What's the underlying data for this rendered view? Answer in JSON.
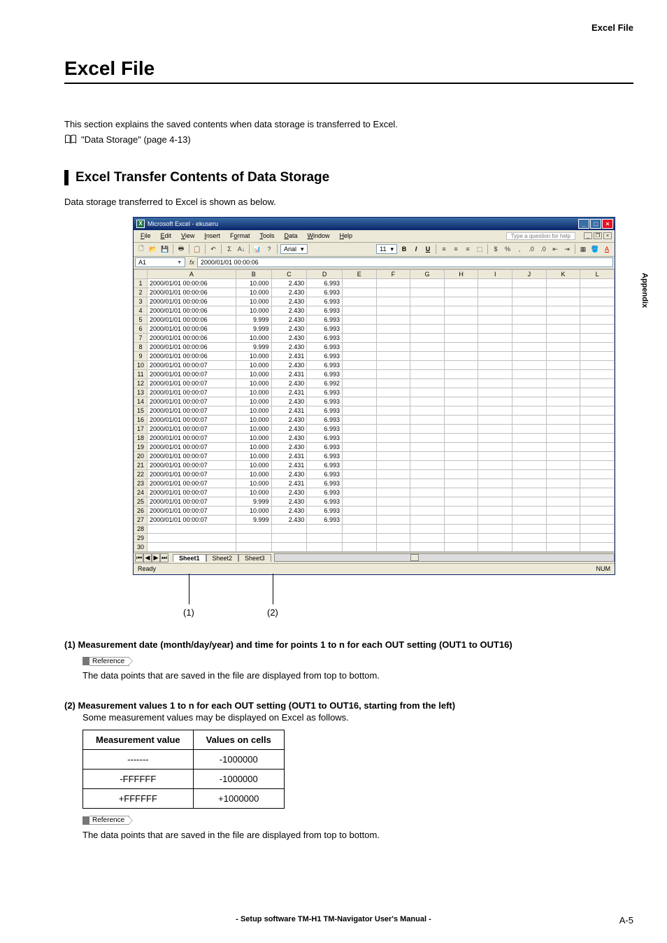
{
  "header": {
    "right_label": "Excel File",
    "side_tab": "Appendix"
  },
  "title": "Excel File",
  "intro": {
    "line1": "This section explains the saved contents when data storage is transferred to Excel.",
    "xref": "\"Data Storage\" (page 4-13)"
  },
  "subheading": "Excel Transfer Contents of Data Storage",
  "subintro": "Data storage transferred to Excel is shown as below.",
  "excel": {
    "window_title": "Microsoft Excel - ekuseru",
    "menus": [
      "File",
      "Edit",
      "View",
      "Insert",
      "Format",
      "Tools",
      "Data",
      "Window",
      "Help"
    ],
    "help_placeholder": "Type a question for help",
    "font_name": "Arial",
    "font_size": "11",
    "namebox": "A1",
    "formula_value": "2000/01/01 00:00:06",
    "col_headers": [
      "A",
      "B",
      "C",
      "D",
      "E",
      "F",
      "G",
      "H",
      "I",
      "J",
      "K",
      "L"
    ],
    "rows": [
      {
        "r": 1,
        "a": "2000/01/01 00:00:06",
        "b": "10.000",
        "c": "2.430",
        "d": "6.993"
      },
      {
        "r": 2,
        "a": "2000/01/01 00:00:06",
        "b": "10.000",
        "c": "2.430",
        "d": "6.993"
      },
      {
        "r": 3,
        "a": "2000/01/01 00:00:06",
        "b": "10.000",
        "c": "2.430",
        "d": "6.993"
      },
      {
        "r": 4,
        "a": "2000/01/01 00:00:06",
        "b": "10.000",
        "c": "2.430",
        "d": "6.993"
      },
      {
        "r": 5,
        "a": "2000/01/01 00:00:06",
        "b": "9.999",
        "c": "2.430",
        "d": "6.993"
      },
      {
        "r": 6,
        "a": "2000/01/01 00:00:06",
        "b": "9.999",
        "c": "2.430",
        "d": "6.993"
      },
      {
        "r": 7,
        "a": "2000/01/01 00:00:06",
        "b": "10.000",
        "c": "2.430",
        "d": "6.993"
      },
      {
        "r": 8,
        "a": "2000/01/01 00:00:06",
        "b": "9.999",
        "c": "2.430",
        "d": "6.993"
      },
      {
        "r": 9,
        "a": "2000/01/01 00:00:06",
        "b": "10.000",
        "c": "2.431",
        "d": "6.993"
      },
      {
        "r": 10,
        "a": "2000/01/01 00:00:07",
        "b": "10.000",
        "c": "2.430",
        "d": "6.993"
      },
      {
        "r": 11,
        "a": "2000/01/01 00:00:07",
        "b": "10.000",
        "c": "2.431",
        "d": "6.993"
      },
      {
        "r": 12,
        "a": "2000/01/01 00:00:07",
        "b": "10.000",
        "c": "2.430",
        "d": "6.992"
      },
      {
        "r": 13,
        "a": "2000/01/01 00:00:07",
        "b": "10.000",
        "c": "2.431",
        "d": "6.993"
      },
      {
        "r": 14,
        "a": "2000/01/01 00:00:07",
        "b": "10.000",
        "c": "2.430",
        "d": "6.993"
      },
      {
        "r": 15,
        "a": "2000/01/01 00:00:07",
        "b": "10.000",
        "c": "2.431",
        "d": "6.993"
      },
      {
        "r": 16,
        "a": "2000/01/01 00:00:07",
        "b": "10.000",
        "c": "2.430",
        "d": "6.993"
      },
      {
        "r": 17,
        "a": "2000/01/01 00:00:07",
        "b": "10.000",
        "c": "2.430",
        "d": "6.993"
      },
      {
        "r": 18,
        "a": "2000/01/01 00:00:07",
        "b": "10.000",
        "c": "2.430",
        "d": "6.993"
      },
      {
        "r": 19,
        "a": "2000/01/01 00:00:07",
        "b": "10.000",
        "c": "2.430",
        "d": "6.993"
      },
      {
        "r": 20,
        "a": "2000/01/01 00:00:07",
        "b": "10.000",
        "c": "2.431",
        "d": "6.993"
      },
      {
        "r": 21,
        "a": "2000/01/01 00:00:07",
        "b": "10.000",
        "c": "2.431",
        "d": "6.993"
      },
      {
        "r": 22,
        "a": "2000/01/01 00:00:07",
        "b": "10.000",
        "c": "2.430",
        "d": "6.993"
      },
      {
        "r": 23,
        "a": "2000/01/01 00:00:07",
        "b": "10.000",
        "c": "2.431",
        "d": "6.993"
      },
      {
        "r": 24,
        "a": "2000/01/01 00:00:07",
        "b": "10.000",
        "c": "2.430",
        "d": "6.993"
      },
      {
        "r": 25,
        "a": "2000/01/01 00:00:07",
        "b": "9.999",
        "c": "2.430",
        "d": "6.993"
      },
      {
        "r": 26,
        "a": "2000/01/01 00:00:07",
        "b": "10.000",
        "c": "2.430",
        "d": "6.993"
      },
      {
        "r": 27,
        "a": "2000/01/01 00:00:07",
        "b": "9.999",
        "c": "2.430",
        "d": "6.993"
      }
    ],
    "blank_rows": [
      28,
      29,
      30
    ],
    "sheet_tabs": [
      "Sheet1",
      "Sheet2",
      "Sheet3"
    ],
    "status_left": "Ready",
    "status_right": "NUM"
  },
  "callouts": {
    "c1": "(1)",
    "c2": "(2)"
  },
  "item1": {
    "heading": "(1) Measurement date (month/day/year) and time for points 1 to n for each OUT setting (OUT1 to OUT16)",
    "ref_label": "Reference",
    "text": "The data points that are saved in the file are displayed from top to bottom."
  },
  "item2": {
    "heading": "(2) Measurement values 1 to n for each OUT setting (OUT1 to OUT16, starting from the left)",
    "lead": "Some measurement values may be displayed on Excel as follows.",
    "table": {
      "h1": "Measurement value",
      "h2": "Values on cells",
      "rows": [
        {
          "mv": "-------",
          "vc": "-1000000"
        },
        {
          "mv": "-FFFFFF",
          "vc": "-1000000"
        },
        {
          "mv": "+FFFFFF",
          "vc": "+1000000"
        }
      ]
    },
    "ref_label": "Reference",
    "text": "The data points that are saved in the file are displayed from top to bottom."
  },
  "footer": {
    "center": "- Setup software TM-H1 TM-Navigator User's Manual -",
    "page": "A-5"
  }
}
